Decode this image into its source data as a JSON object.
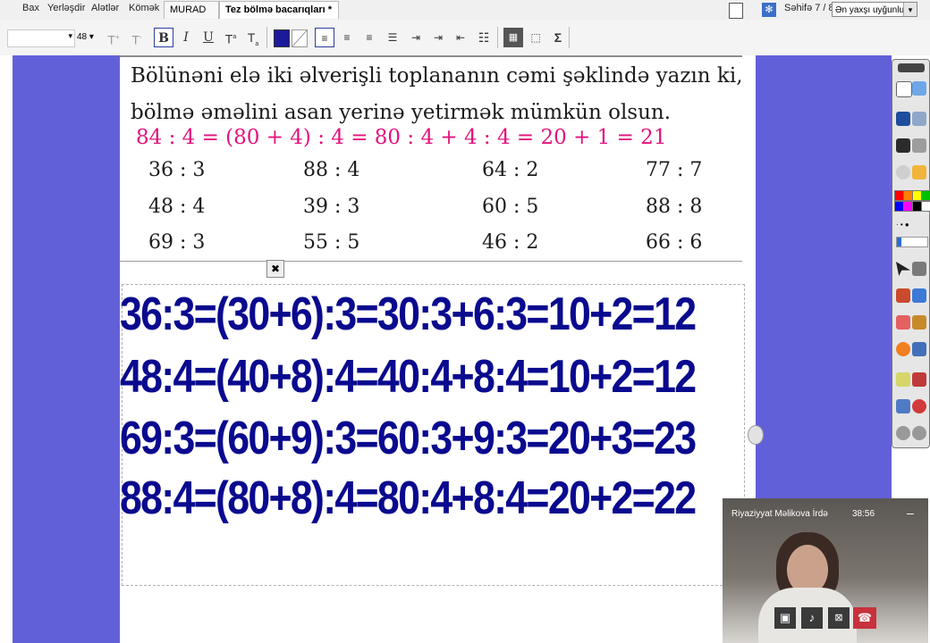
{
  "menu": [
    "Bax",
    "Yerləşdir",
    "Alətlər",
    "Kömək"
  ],
  "tabs": [
    {
      "label": "MURAD",
      "close": "⊗"
    },
    {
      "label": "Tez bölmə bacarıqları *",
      "close": "⊗"
    }
  ],
  "page_indicator": "Səhifə 7 / 8",
  "zoom_select": "Ən yaxşı uyğunluq",
  "toolbar": {
    "font_size": "48",
    "bold": "B",
    "italic": "I",
    "underline": "U",
    "superscript": "T",
    "subscript": "T",
    "sigma": "Σ"
  },
  "book": {
    "instruction_line1": "Bölünəni elə iki əlverişli toplananın cəmi şəklində yazın ki,",
    "instruction_line2": "bölmə əməlini asan yerinə yetirmək mümkün olsun.",
    "example": "84 : 4 = (80 + 4) : 4 = 80 : 4 + 4 : 4 = 20 + 1 = 21",
    "problems": [
      [
        "36 : 3",
        "88 : 4",
        "64 : 2",
        "77 : 7"
      ],
      [
        "48 : 4",
        "39 : 3",
        "60 : 5",
        "88 : 8"
      ],
      [
        "69 : 3",
        "55 : 5",
        "46 : 2",
        "66 : 6"
      ]
    ]
  },
  "answers": [
    "36:3=(30+6):3=30:3+6:3=10+2=12",
    "48:4=(40+8):4=40:4+8:4=10+2=12",
    "69:3=(60+9):3=60:3+9:3=20+3=23",
    "88:4=(80+8):4=80:4+8:4=20+2=22"
  ],
  "video": {
    "caller": "Riyaziyyat Məlikova İrdə",
    "timer": "38:56",
    "minimize": "–"
  },
  "colors": {
    "stage": "#6260d8",
    "answer_text": "#0a0a8f",
    "example_pink": "#e3127c",
    "end_call": "#c8323c"
  },
  "palette_colors": [
    "#ff0000",
    "#ff8000",
    "#ffff00",
    "#00c000",
    "#0000ff",
    "#ff00ff",
    "#000000",
    "#ffffff"
  ]
}
